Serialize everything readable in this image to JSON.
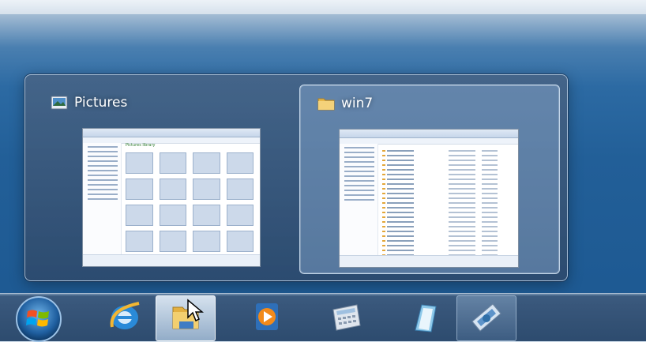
{
  "flyout": {
    "thumbnails": [
      {
        "title": "Pictures",
        "icon": "pictures-library-icon",
        "preview_heading": "Pictures library",
        "selected": false
      },
      {
        "title": "win7",
        "icon": "folder-icon",
        "preview_heading": "",
        "selected": true
      }
    ]
  },
  "taskbar": {
    "items": [
      {
        "name": "start-button",
        "icon": "windows-logo-icon",
        "state": "normal"
      },
      {
        "name": "internet-explorer",
        "icon": "internet-explorer-icon",
        "state": "normal"
      },
      {
        "name": "windows-explorer",
        "icon": "windows-explorer-icon",
        "state": "active"
      },
      {
        "name": "windows-media-player",
        "icon": "media-player-icon",
        "state": "normal"
      },
      {
        "name": "calculator",
        "icon": "calculator-icon",
        "state": "normal"
      },
      {
        "name": "notepad",
        "icon": "notepad-icon",
        "state": "normal"
      },
      {
        "name": "control-panel",
        "icon": "control-panel-icon",
        "state": "running"
      }
    ]
  },
  "colors": {
    "desktop": "#1e5a93",
    "flyout_bg": "#3e6892",
    "selected_thumb": "#8cafd7",
    "taskbar": "#2d4b6e"
  }
}
